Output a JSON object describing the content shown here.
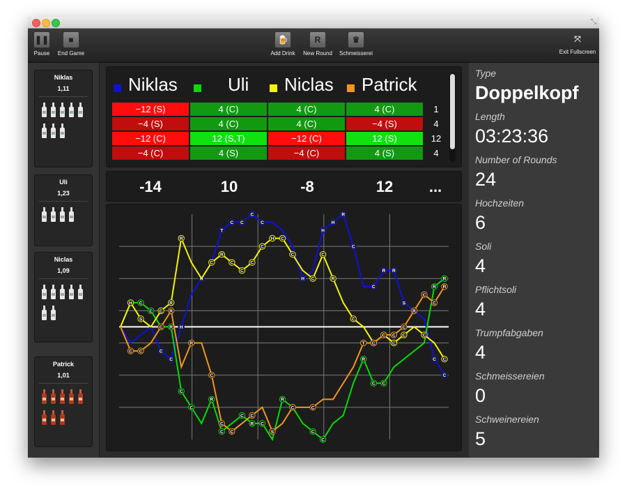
{
  "toolbar": {
    "pause": "Pause",
    "end_game": "End Game",
    "add_drink": "Add Drink",
    "new_round": "New Round",
    "schmeisserei": "Schmeisserei",
    "exit_fullscreen": "Exit Fullscreen"
  },
  "players": [
    {
      "name": "Niklas",
      "value": "1,11",
      "bottles": 8,
      "bottle_style": "white"
    },
    {
      "name": "Uli",
      "value": "1,23",
      "bottles": 4,
      "bottle_style": "white"
    },
    {
      "name": "Niclas",
      "value": "1,09",
      "bottles": 7,
      "bottle_style": "white"
    },
    {
      "name": "Patrick",
      "value": "1,01",
      "bottles": 8,
      "bottle_style": "red"
    }
  ],
  "score_header": [
    {
      "name": "Niklas",
      "color": "#1010dd"
    },
    {
      "name": "Uli",
      "color": "#00dd00"
    },
    {
      "name": "Niclas",
      "color": "#f5f500"
    },
    {
      "name": "Patrick",
      "color": "#f0961e"
    }
  ],
  "score_rows": [
    {
      "cells": [
        {
          "text": "−12 (S)",
          "color": "#ff0d0d"
        },
        {
          "text": "4 (C)",
          "color": "#119a11"
        },
        {
          "text": "4 (C)",
          "color": "#119a11"
        },
        {
          "text": "4 (C)",
          "color": "#119a11"
        }
      ],
      "round": "1"
    },
    {
      "cells": [
        {
          "text": "−4 (S)",
          "color": "#c00d0d"
        },
        {
          "text": "4 (C)",
          "color": "#119a11"
        },
        {
          "text": "4 (C)",
          "color": "#119a11"
        },
        {
          "text": "−4 (S)",
          "color": "#c00d0d"
        }
      ],
      "round": "4"
    },
    {
      "cells": [
        {
          "text": "−12 (C)",
          "color": "#ff0d0d"
        },
        {
          "text": "12 (S,T)",
          "color": "#11e011"
        },
        {
          "text": "−12 (C)",
          "color": "#ff0d0d"
        },
        {
          "text": "12 (S)",
          "color": "#11e011"
        }
      ],
      "round": "12"
    },
    {
      "cells": [
        {
          "text": "−4 (C)",
          "color": "#c00d0d"
        },
        {
          "text": "4 (S)",
          "color": "#119a11"
        },
        {
          "text": "−4 (C)",
          "color": "#c00d0d"
        },
        {
          "text": "4 (S)",
          "color": "#119a11"
        }
      ],
      "round": "4"
    }
  ],
  "totals": [
    "-14",
    "10",
    "-8",
    "12",
    "..."
  ],
  "stats": [
    {
      "label": "Type",
      "value": "Doppelkopf"
    },
    {
      "label": "Length",
      "value": "03:23:36"
    },
    {
      "label": "Number of Rounds",
      "value": "24"
    },
    {
      "label": "Hochzeiten",
      "value": "6"
    },
    {
      "label": "Soli",
      "value": "4"
    },
    {
      "label": "Pflichtsoli",
      "value": "4"
    },
    {
      "label": "Trumpfabgaben",
      "value": "4"
    },
    {
      "label": "Schmeissereien",
      "value": "0"
    },
    {
      "label": "Schweinereien",
      "value": "5"
    }
  ],
  "chart_data": {
    "type": "line",
    "x": [
      0,
      1,
      2,
      3,
      4,
      5,
      6,
      7,
      8,
      9,
      10,
      11,
      12,
      13,
      14,
      15,
      16,
      17,
      18,
      19,
      20,
      21,
      22,
      23,
      24,
      25,
      26,
      27,
      28,
      29,
      30,
      31,
      32,
      33,
      34,
      35,
      36,
      37,
      38
    ],
    "ylim": [
      -14,
      14
    ],
    "series": [
      {
        "name": "Niklas",
        "color": "#1010dd",
        "values": [
          0,
          -2,
          -1,
          0,
          -3,
          -4,
          0,
          4,
          6,
          8,
          12,
          13,
          13,
          14,
          13,
          13,
          12,
          10,
          6,
          7,
          12,
          13,
          14,
          10,
          5,
          5,
          7,
          7,
          3,
          2,
          1,
          -4,
          -6
        ],
        "markers": [
          "",
          "",
          "",
          "",
          "C",
          "C",
          "H",
          "",
          "H",
          "",
          "T",
          "C",
          "C",
          "C",
          "C",
          "",
          "",
          "",
          "H",
          "",
          "H",
          "H",
          "R",
          "C",
          "",
          "C",
          "R",
          "R",
          "S",
          "",
          "",
          "C",
          "C"
        ]
      },
      {
        "name": "Uli",
        "color": "#00dd00",
        "values": [
          0,
          3,
          3,
          2,
          0,
          0,
          -8,
          -10,
          -12,
          -9,
          -13,
          -12,
          -11,
          -12,
          -12,
          -14,
          -9,
          -10,
          -12,
          -13,
          -14,
          -12,
          -11,
          -7,
          -4,
          -7,
          -7,
          -5,
          -4,
          -3,
          -2,
          5,
          6
        ],
        "markers": [
          "",
          "H",
          "C",
          "C",
          "",
          "R",
          "C",
          "C",
          "",
          "R",
          "C",
          "",
          "C",
          "R",
          "C",
          "",
          "R",
          "C",
          "",
          "C",
          "C",
          "",
          "",
          "",
          "R",
          "C",
          "C",
          "",
          "",
          "",
          "",
          "R",
          "R"
        ]
      },
      {
        "name": "Niclas",
        "color": "#f5f500",
        "values": [
          0,
          3,
          1,
          0,
          2,
          3,
          11,
          8,
          6,
          8,
          9,
          8,
          7,
          8,
          10,
          11,
          11,
          9,
          7,
          6,
          9,
          6,
          3,
          1,
          0,
          -2,
          -1,
          -2,
          -1,
          0,
          -1,
          -2,
          -4
        ],
        "markers": [
          "",
          "H",
          "S",
          "",
          "C",
          "R",
          "R",
          "",
          "",
          "C",
          "R",
          "C",
          "C",
          "C",
          "C",
          "H",
          "C",
          "C",
          "",
          "C",
          "C",
          "R",
          "",
          "C",
          "",
          "C",
          "C",
          "C",
          "C",
          "",
          "C",
          "",
          "C"
        ]
      },
      {
        "name": "Patrick",
        "color": "#f0961e",
        "values": [
          0,
          -3,
          -3,
          -2,
          0,
          2,
          -5,
          -2,
          -2,
          -6,
          -12,
          -13,
          -12,
          -11,
          -10,
          -13,
          -12,
          -10,
          -10,
          -10,
          -9,
          -9,
          -7,
          -5,
          -2,
          -2,
          -1,
          -1,
          0,
          2,
          4,
          3,
          5
        ],
        "markers": [
          "",
          "C",
          "C",
          "",
          "C",
          "R",
          "",
          "R",
          "",
          "C",
          "C",
          "C",
          "",
          "C",
          "",
          "S",
          "",
          "C",
          "",
          "C",
          "",
          "",
          "",
          "",
          "T",
          "C",
          "C",
          "C",
          "C",
          "R",
          "C",
          "C",
          "R"
        ]
      }
    ]
  }
}
